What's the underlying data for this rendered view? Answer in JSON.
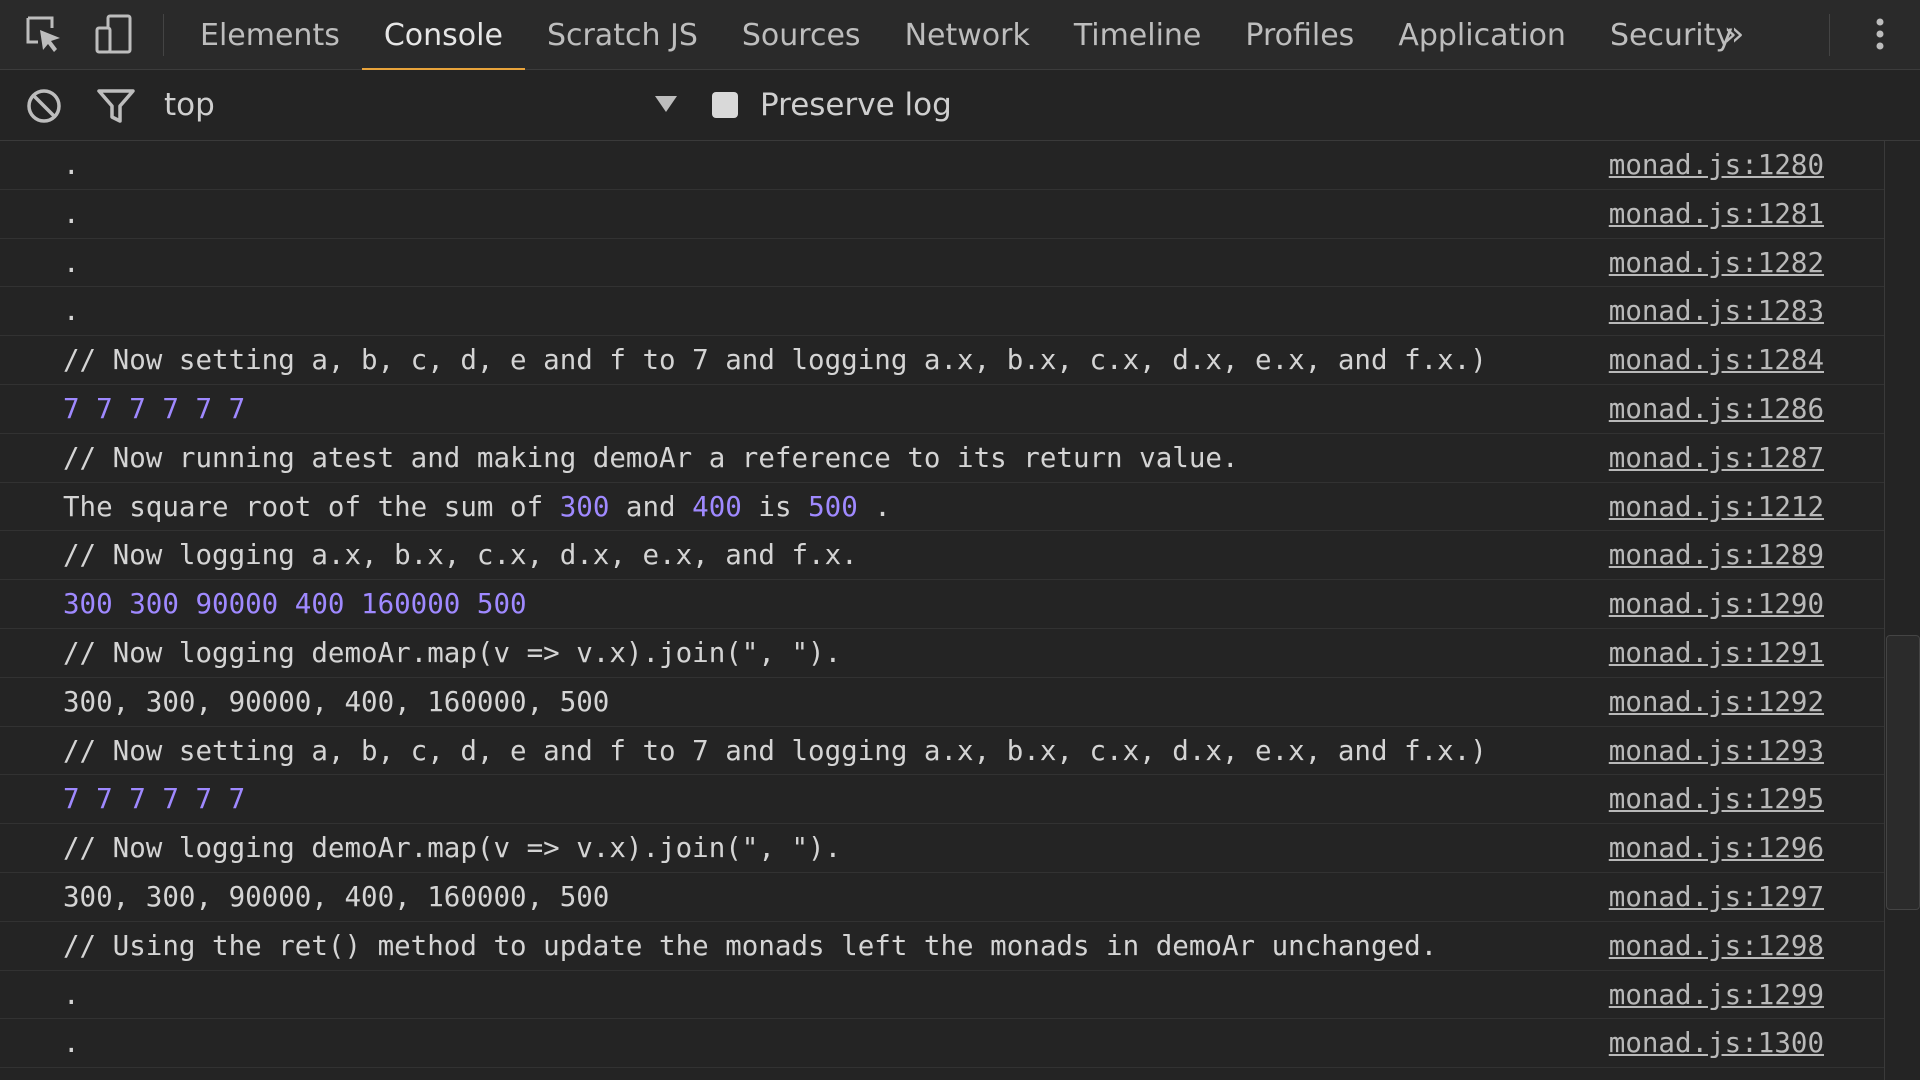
{
  "toolbar": {
    "inspect_icon": "inspect-element-icon",
    "device_icon": "device-mode-icon",
    "tabs": [
      {
        "label": "Elements"
      },
      {
        "label": "Console"
      },
      {
        "label": "Scratch JS"
      },
      {
        "label": "Sources"
      },
      {
        "label": "Network"
      },
      {
        "label": "Timeline"
      },
      {
        "label": "Profiles"
      },
      {
        "label": "Application"
      },
      {
        "label": "Security"
      }
    ],
    "active_tab": "Console",
    "more_label": "»",
    "accent_color": "#e8a33b"
  },
  "filter": {
    "clear_icon": "clear-console-icon",
    "filter_icon": "filter-icon",
    "context": "top",
    "preserve_log_label": "Preserve log",
    "preserve_log_checked": false
  },
  "colors": {
    "number": "#9f89ff",
    "text": "#d4d4d4",
    "background": "#242424"
  },
  "console": {
    "rows": [
      {
        "parts": [
          {
            "t": "."
          }
        ],
        "src": "monad.js:1280"
      },
      {
        "parts": [
          {
            "t": "."
          }
        ],
        "src": "monad.js:1281"
      },
      {
        "parts": [
          {
            "t": "."
          }
        ],
        "src": "monad.js:1282"
      },
      {
        "parts": [
          {
            "t": "."
          }
        ],
        "src": "monad.js:1283"
      },
      {
        "parts": [
          {
            "t": "// Now setting a, b, c, d, e and f to 7 and logging a.x, b.x, c.x, d.x, e.x, and f.x.)"
          }
        ],
        "src": "monad.js:1284"
      },
      {
        "parts": [
          {
            "t": "7 7 7 7 7 7",
            "n": true
          }
        ],
        "src": "monad.js:1286"
      },
      {
        "parts": [
          {
            "t": "// Now running atest and making demoAr a reference to its return value."
          }
        ],
        "src": "monad.js:1287"
      },
      {
        "parts": [
          {
            "t": "The square root of the sum of "
          },
          {
            "t": "300",
            "n": true
          },
          {
            "t": " and "
          },
          {
            "t": "400",
            "n": true
          },
          {
            "t": " is "
          },
          {
            "t": "500",
            "n": true
          },
          {
            "t": " ."
          }
        ],
        "src": "monad.js:1212"
      },
      {
        "parts": [
          {
            "t": "// Now logging a.x, b.x, c.x, d.x, e.x, and f.x."
          }
        ],
        "src": "monad.js:1289"
      },
      {
        "parts": [
          {
            "t": "300 300 90000 400 160000 500",
            "n": true
          }
        ],
        "src": "monad.js:1290"
      },
      {
        "parts": [
          {
            "t": "// Now logging demoAr.map(v => v.x).join(\", \")."
          }
        ],
        "src": "monad.js:1291"
      },
      {
        "parts": [
          {
            "t": "300, 300, 90000, 400, 160000, 500"
          }
        ],
        "src": "monad.js:1292"
      },
      {
        "parts": [
          {
            "t": "// Now setting a, b, c, d, e and f to 7 and logging a.x, b.x, c.x, d.x, e.x, and f.x.)"
          }
        ],
        "src": "monad.js:1293"
      },
      {
        "parts": [
          {
            "t": "7 7 7 7 7 7",
            "n": true
          }
        ],
        "src": "monad.js:1295"
      },
      {
        "parts": [
          {
            "t": "// Now logging demoAr.map(v => v.x).join(\", \")."
          }
        ],
        "src": "monad.js:1296"
      },
      {
        "parts": [
          {
            "t": "300, 300, 90000, 400, 160000, 500"
          }
        ],
        "src": "monad.js:1297"
      },
      {
        "parts": [
          {
            "t": "// Using the ret() method to update the monads left the monads in demoAr unchanged."
          }
        ],
        "src": "monad.js:1298"
      },
      {
        "parts": [
          {
            "t": "."
          }
        ],
        "src": "monad.js:1299"
      },
      {
        "parts": [
          {
            "t": "."
          }
        ],
        "src": "monad.js:1300"
      }
    ]
  }
}
